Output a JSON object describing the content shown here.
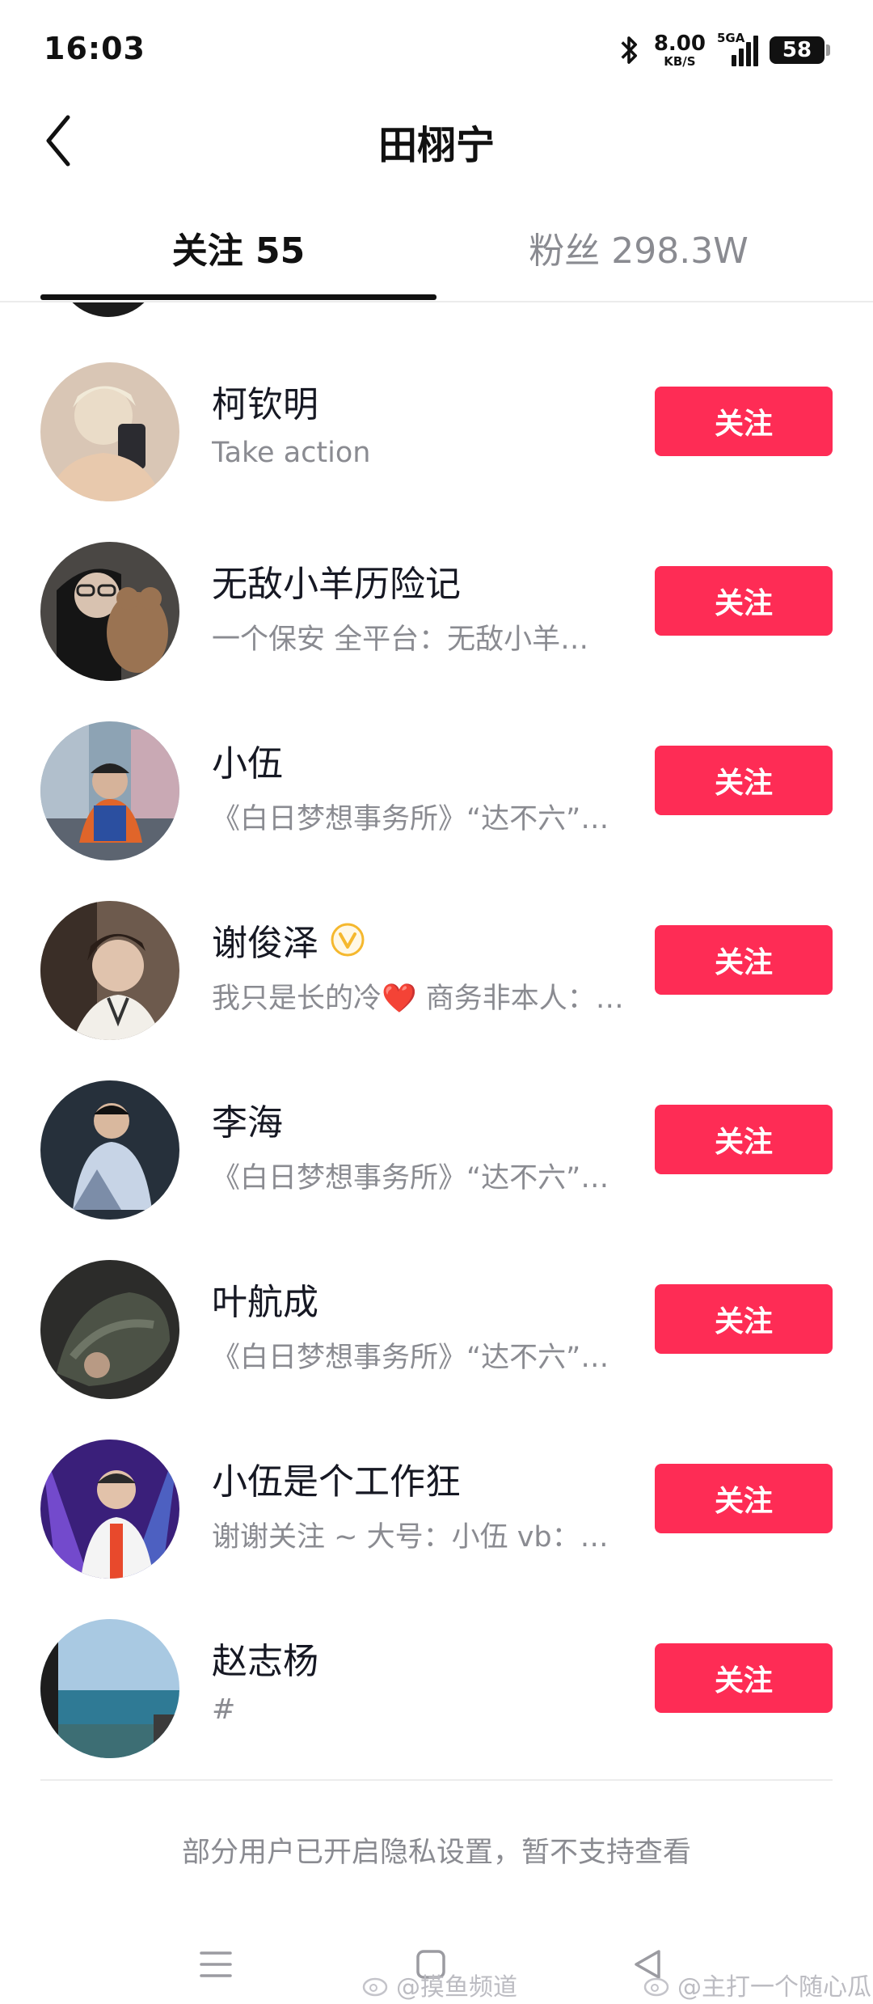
{
  "status_bar": {
    "time": "16:03",
    "net_speed_value": "8.00",
    "net_speed_unit": "KB/S",
    "network_type": "5GA",
    "battery_level": "58"
  },
  "header": {
    "title": "田栩宁"
  },
  "tabs": [
    {
      "label": "关注 55",
      "active": true
    },
    {
      "label": "粉丝 298.3W",
      "active": false
    }
  ],
  "users": [
    {
      "name": "柯钦明",
      "bio": "Take action",
      "verified": false,
      "button": "关注"
    },
    {
      "name": "无敌小羊历险记",
      "bio": "一个保安 全平台：无敌小羊…",
      "verified": false,
      "button": "关注"
    },
    {
      "name": "小伍",
      "bio": "《白日梦想事务所》“达不六”…",
      "verified": false,
      "button": "关注"
    },
    {
      "name": "谢俊泽",
      "bio": "我只是长的冷❤️ 商务非本人：…",
      "verified": true,
      "button": "关注"
    },
    {
      "name": "李海",
      "bio": "《白日梦想事务所》“达不六”…",
      "verified": false,
      "button": "关注"
    },
    {
      "name": "叶航成",
      "bio": "《白日梦想事务所》“达不六”…",
      "verified": false,
      "button": "关注"
    },
    {
      "name": "小伍是个工作狂",
      "bio": "谢谢关注 ~ 大号：小伍 vb：…",
      "verified": false,
      "button": "关注"
    },
    {
      "name": "赵志杨",
      "bio": "#",
      "verified": false,
      "button": "关注"
    }
  ],
  "footer": {
    "privacy_note": "部分用户已开启隐私设置，暂不支持查看"
  },
  "watermarks": [
    "@摸鱼频道",
    "@主打一个随心瓜"
  ],
  "colors": {
    "accent": "#fe2c55",
    "text_primary": "#161823",
    "text_secondary": "#8a8b91",
    "verified": "#f5b82e"
  },
  "icons": {
    "back": "chevron-left-icon",
    "bluetooth": "bluetooth-icon",
    "verified": "verified-badge-icon",
    "menu": "menu-icon",
    "home": "home-square-icon",
    "back_nav": "back-triangle-icon"
  }
}
